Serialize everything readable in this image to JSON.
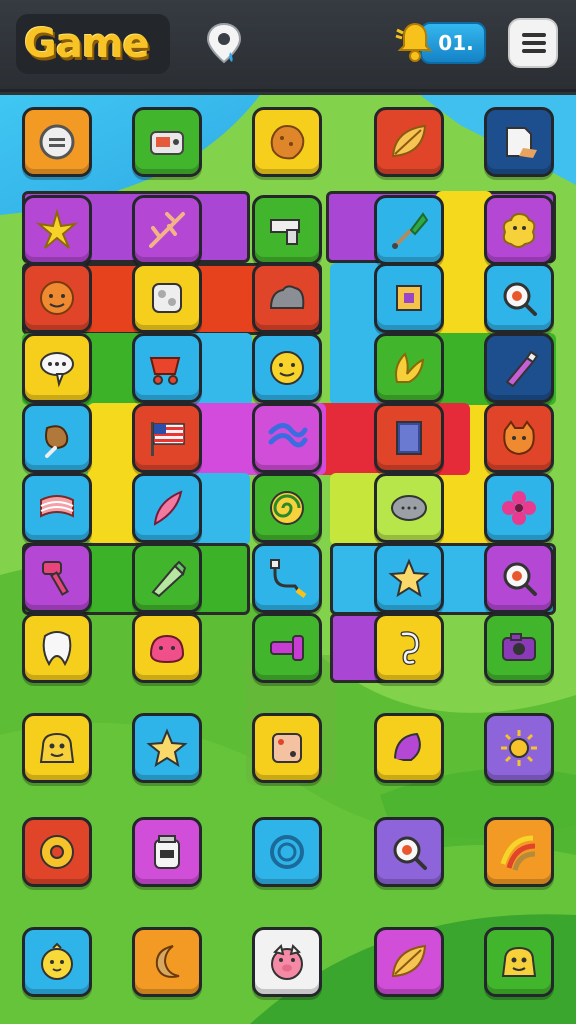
{
  "header": {
    "title": "Game",
    "score": "01.",
    "pin_icon": "location-pin-icon",
    "bell_icon": "bell-icon",
    "menu_icon": "hamburger-menu-icon"
  },
  "colors": {
    "orange": "#f39a24",
    "green": "#41b52c",
    "yellow": "#f6cf1c",
    "navy": "#1d4f8f",
    "purple": "#b547d5",
    "red": "#e0452a",
    "blue": "#2fb4e9",
    "lime": "#b6e64a",
    "white": "#f2f2f2",
    "violet": "#8d64d9",
    "magenta": "#d14ed8"
  },
  "board": {
    "tiles": [
      {
        "row": 0,
        "col": 0,
        "color": "orange",
        "icon": "button-icon"
      },
      {
        "row": 0,
        "col": 1,
        "color": "green",
        "icon": "toaster-icon"
      },
      {
        "row": 0,
        "col": 2,
        "color": "yellow",
        "icon": "cookie-icon"
      },
      {
        "row": 0,
        "col": 3,
        "color": "red",
        "icon": "leaf-icon"
      },
      {
        "row": 0,
        "col": 4,
        "color": "navy",
        "icon": "paper-icon"
      },
      {
        "row": 1,
        "col": 0,
        "color": "purple",
        "icon": "starfish-icon"
      },
      {
        "row": 1,
        "col": 1,
        "color": "purple",
        "icon": "twig-icon"
      },
      {
        "row": 1,
        "col": 2,
        "color": "green",
        "icon": "gun-icon"
      },
      {
        "row": 1,
        "col": 3,
        "color": "blue",
        "icon": "shovel-icon"
      },
      {
        "row": 1,
        "col": 4,
        "color": "purple",
        "icon": "blob-icon"
      },
      {
        "row": 2,
        "col": 0,
        "color": "red",
        "icon": "face-icon"
      },
      {
        "row": 2,
        "col": 1,
        "color": "yellow",
        "icon": "machine-icon"
      },
      {
        "row": 2,
        "col": 2,
        "color": "red",
        "icon": "rock-icon"
      },
      {
        "row": 2,
        "col": 3,
        "color": "blue",
        "icon": "box-icon"
      },
      {
        "row": 2,
        "col": 4,
        "color": "blue",
        "icon": "magnifier-icon"
      },
      {
        "row": 3,
        "col": 0,
        "color": "yellow",
        "icon": "speech-bubble-icon"
      },
      {
        "row": 3,
        "col": 1,
        "color": "blue",
        "icon": "cart-icon"
      },
      {
        "row": 3,
        "col": 2,
        "color": "blue",
        "icon": "smiley-icon"
      },
      {
        "row": 3,
        "col": 3,
        "color": "green",
        "icon": "banana-icon"
      },
      {
        "row": 3,
        "col": 4,
        "color": "navy",
        "icon": "pen-icon"
      },
      {
        "row": 4,
        "col": 0,
        "color": "blue",
        "icon": "drumstick-icon"
      },
      {
        "row": 4,
        "col": 1,
        "color": "red",
        "icon": "flag-icon"
      },
      {
        "row": 4,
        "col": 2,
        "color": "magenta",
        "icon": "ribbon-icon"
      },
      {
        "row": 4,
        "col": 3,
        "color": "red",
        "icon": "book-icon"
      },
      {
        "row": 4,
        "col": 4,
        "color": "red",
        "icon": "cat-face-icon"
      },
      {
        "row": 5,
        "col": 0,
        "color": "blue",
        "icon": "bacon-icon"
      },
      {
        "row": 5,
        "col": 1,
        "color": "blue",
        "icon": "feather-icon"
      },
      {
        "row": 5,
        "col": 2,
        "color": "green",
        "icon": "swirl-icon"
      },
      {
        "row": 5,
        "col": 3,
        "color": "lime",
        "icon": "pebble-icon"
      },
      {
        "row": 5,
        "col": 4,
        "color": "blue",
        "icon": "flower-icon"
      },
      {
        "row": 6,
        "col": 0,
        "color": "purple",
        "icon": "hammer-icon"
      },
      {
        "row": 6,
        "col": 1,
        "color": "green",
        "icon": "marker-icon"
      },
      {
        "row": 6,
        "col": 2,
        "color": "blue",
        "icon": "cable-icon"
      },
      {
        "row": 6,
        "col": 3,
        "color": "blue",
        "icon": "star-icon"
      },
      {
        "row": 6,
        "col": 4,
        "color": "purple",
        "icon": "magnifier-icon"
      },
      {
        "row": 7,
        "col": 0,
        "color": "yellow",
        "icon": "tooth-icon"
      },
      {
        "row": 7,
        "col": 1,
        "color": "yellow",
        "icon": "jelly-icon"
      },
      {
        "row": 7,
        "col": 2,
        "color": "green",
        "icon": "bolt-icon"
      },
      {
        "row": 7,
        "col": 3,
        "color": "yellow",
        "icon": "hook-icon"
      },
      {
        "row": 7,
        "col": 4,
        "color": "green",
        "icon": "camera-icon"
      },
      {
        "row": 8,
        "col": 0,
        "color": "yellow",
        "icon": "monster-icon"
      },
      {
        "row": 8,
        "col": 1,
        "color": "blue",
        "icon": "star-icon"
      },
      {
        "row": 8,
        "col": 2,
        "color": "yellow",
        "icon": "dice-icon"
      },
      {
        "row": 8,
        "col": 3,
        "color": "yellow",
        "icon": "shell-icon"
      },
      {
        "row": 8,
        "col": 4,
        "color": "violet",
        "icon": "sun-icon"
      },
      {
        "row": 9,
        "col": 0,
        "color": "red",
        "icon": "donut-icon"
      },
      {
        "row": 9,
        "col": 1,
        "color": "magenta",
        "icon": "jar-icon"
      },
      {
        "row": 9,
        "col": 2,
        "color": "blue",
        "icon": "ring-icon"
      },
      {
        "row": 9,
        "col": 3,
        "color": "violet",
        "icon": "magnifier-icon"
      },
      {
        "row": 9,
        "col": 4,
        "color": "orange",
        "icon": "rainbow-icon"
      },
      {
        "row": 10,
        "col": 0,
        "color": "blue",
        "icon": "chick-icon"
      },
      {
        "row": 10,
        "col": 1,
        "color": "orange",
        "icon": "moon-icon"
      },
      {
        "row": 10,
        "col": 2,
        "color": "white",
        "icon": "pig-icon"
      },
      {
        "row": 10,
        "col": 3,
        "color": "magenta",
        "icon": "leaf-icon"
      },
      {
        "row": 10,
        "col": 4,
        "color": "green",
        "icon": "monster-icon"
      }
    ]
  }
}
